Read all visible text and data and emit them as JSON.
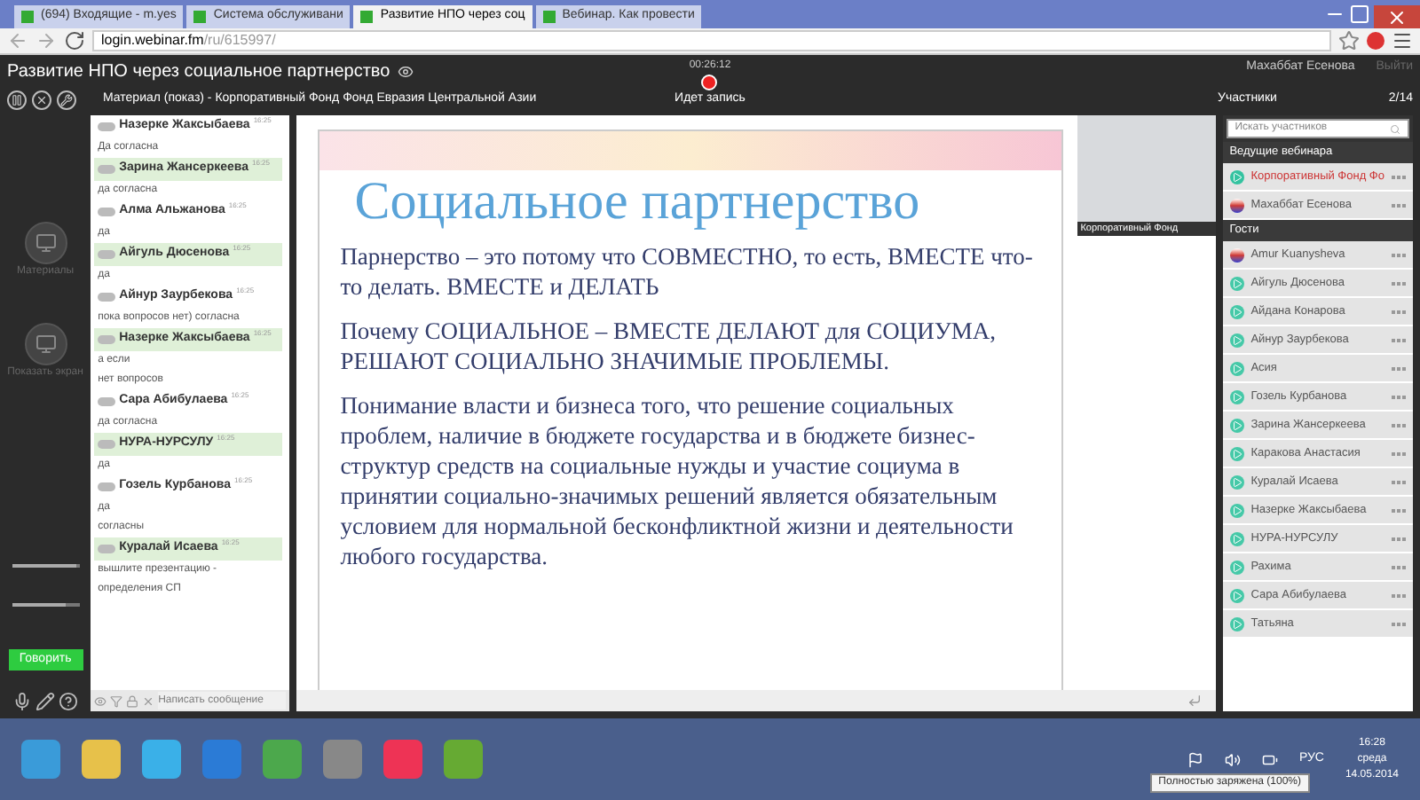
{
  "browser": {
    "tabs": [
      {
        "label": "(694) Входящие - m.yes",
        "selected": false
      },
      {
        "label": "Система обслуживани",
        "selected": false
      },
      {
        "label": "Развитие НПО через соц",
        "selected": true
      },
      {
        "label": "Вебинар. Как провести",
        "selected": false
      }
    ],
    "address": {
      "host": "login.webinar.fm",
      "path": "/ru/615997/"
    }
  },
  "header": {
    "title": "Развитие НПО через социальное партнерство",
    "timer": "00:26:12",
    "recording": "Идет запись",
    "user": "Махаббат Есенова",
    "logout": "Выйти",
    "material": "Материал (показ) - Корпоративный Фонд Фонд Евразия Центральной Азии"
  },
  "sidebar": {
    "items": [
      {
        "label": "Материалы"
      },
      {
        "label": "Показать экран"
      }
    ],
    "sliders": [
      {
        "level": 0.95
      },
      {
        "level": 0.8
      }
    ],
    "speak_button": "Говорить"
  },
  "chat": {
    "messages": [
      {
        "name": "Назерке Жаксыбаева",
        "time": "16:25",
        "highlighted": false,
        "lines": [
          "Да согласна"
        ]
      },
      {
        "name": "Зарина Жансеркеева",
        "time": "16:25",
        "highlighted": true,
        "lines": [
          "да согласна"
        ]
      },
      {
        "name": "Алма Альжанова",
        "time": "16:25",
        "highlighted": false,
        "lines": [
          "да"
        ]
      },
      {
        "name": "Айгуль Дюсенова",
        "time": "16:25",
        "highlighted": true,
        "lines": [
          "да"
        ]
      },
      {
        "name": "Айнур Заурбекова",
        "time": "16:25",
        "highlighted": false,
        "lines": [
          "пока вопросов нет) согласна"
        ]
      },
      {
        "name": "Назерке Жаксыбаева",
        "time": "16:25",
        "highlighted": true,
        "lines": [
          "а если",
          "нет вопросов"
        ]
      },
      {
        "name": "Сара Абибулаева",
        "time": "16:25",
        "highlighted": false,
        "lines": [
          "да согласна"
        ]
      },
      {
        "name": "НУРА-НУРСУЛУ",
        "time": "16:25",
        "highlighted": true,
        "lines": [
          "да"
        ]
      },
      {
        "name": "Гозель Курбанова",
        "time": "16:25",
        "highlighted": false,
        "lines": [
          "да",
          "согласны"
        ]
      },
      {
        "name": "Куралай Исаева",
        "time": "16:25",
        "highlighted": true,
        "lines": [
          "вышлите презентацию - определения СП"
        ]
      }
    ],
    "input": {
      "placeholder": "Написать сообщение"
    }
  },
  "slide": {
    "title": "Социальное партнерство",
    "paragraphs": [
      "Парнерство – это потому что СОВМЕСТНО, то есть, ВМЕСТЕ  что-то делать. ВМЕСТЕ  и  ДЕЛАТЬ",
      "Почему СОЦИАЛЬНОЕ – ВМЕСТЕ ДЕЛАЮТ  для СОЦИУМА, РЕШАЮТ СОЦИАЛЬНО ЗНАЧИМЫЕ ПРОБЛЕМЫ.",
      "Понимание власти и бизнеса того, что решение социальных проблем, наличие в бюджете государства и в бюджете бизнес-структур средств на социальные нужды и участие социума в принятии социально-значимых решений является обязательным условием для нормальной бесконфликтной жизни и деятельности любого государства."
    ]
  },
  "video": {
    "caption": "Корпоративный Фонд"
  },
  "participants": {
    "title": "Участники",
    "count": "2/14",
    "search": {
      "placeholder": "Искать участников"
    },
    "groups": [
      {
        "title": "Ведущие вебинара",
        "members": [
          {
            "name": "Корпоративный Фонд Фо",
            "kind": "host"
          },
          {
            "name": "Махаббат Есенова",
            "kind": "flag"
          }
        ]
      },
      {
        "title": "Гости",
        "members": [
          {
            "name": "Amur Kuanysheva",
            "kind": "flag"
          },
          {
            "name": "Айгуль Дюсенова",
            "kind": "guest"
          },
          {
            "name": "Айдана Конарова",
            "kind": "guest"
          },
          {
            "name": "Айнур Заурбекова",
            "kind": "guest"
          },
          {
            "name": "Асия",
            "kind": "guest"
          },
          {
            "name": "Гозель Курбанова",
            "kind": "guest"
          },
          {
            "name": "Зарина Жансеркеева",
            "kind": "guest"
          },
          {
            "name": "Каракова Анастасия",
            "kind": "guest"
          },
          {
            "name": "Куралай Исаева",
            "kind": "guest"
          },
          {
            "name": "Назерке Жаксыбаева",
            "kind": "guest"
          },
          {
            "name": "НУРА-НУРСУЛУ",
            "kind": "guest"
          },
          {
            "name": "Рахима",
            "kind": "guest"
          },
          {
            "name": "Сара Абибулаева",
            "kind": "guest"
          },
          {
            "name": "Татьяна",
            "kind": "guest"
          }
        ]
      }
    ]
  },
  "taskbar": {
    "language": "РУС",
    "time": "16:28",
    "weekday": "среда",
    "date": "14.05.2014",
    "tooltip": "Полностью заряжена (100%)"
  }
}
